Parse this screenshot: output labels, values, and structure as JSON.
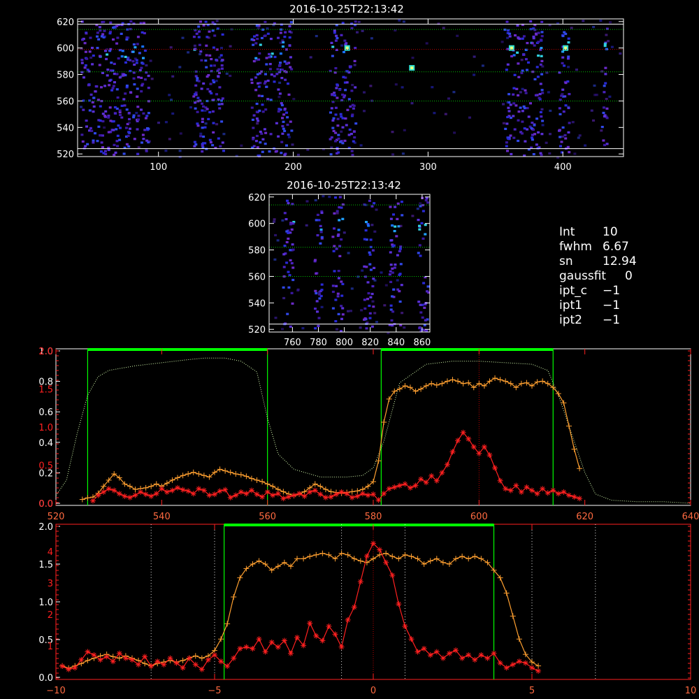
{
  "info": {
    "rows": [
      {
        "label": "Int",
        "value": "10"
      },
      {
        "label": "fwhm",
        "value": "6.67"
      },
      {
        "label": "sn",
        "value": "12.94"
      },
      {
        "label": "gaussfit",
        "value": "0"
      },
      {
        "label": "ipt_c",
        "value": "−1"
      },
      {
        "label": "ipt1",
        "value": "−1"
      },
      {
        "label": "ipt2",
        "value": "−1"
      }
    ]
  },
  "colors": {
    "frame": "#ffffff",
    "red_axis": "#ff2020",
    "orange": "#ffa030",
    "red": "#ff2020",
    "green": "#00ff00",
    "pale_green": "#d8ffb0",
    "dot_green": "#00c000",
    "dot_red": "#c00000"
  },
  "chart_data": [
    {
      "type": "heatmap",
      "title": "2016-10-25T22:13:42",
      "xlim": [
        40,
        445
      ],
      "ylim": [
        518,
        622
      ],
      "xticks": [
        "100",
        "200",
        "300",
        "400"
      ],
      "yticks": [
        "520",
        "540",
        "560",
        "580",
        "600",
        "620"
      ],
      "bands_x": [
        [
          42,
          92
        ],
        [
          125,
          148
        ],
        [
          168,
          198
        ],
        [
          226,
          246
        ],
        [
          356,
          384
        ],
        [
          396,
          404
        ],
        [
          428,
          432
        ]
      ],
      "hot_spots": [
        [
          240,
          600
        ],
        [
          362,
          600
        ],
        [
          402,
          600
        ],
        [
          288,
          585
        ]
      ],
      "hlines_white": [
        618,
        524
      ],
      "hlines_green": [
        614,
        582,
        560
      ],
      "hlines_red": [
        599
      ]
    },
    {
      "type": "heatmap",
      "title": "2016-10-25T22:13:42",
      "xlim": [
        742,
        866
      ],
      "ylim": [
        518,
        622
      ],
      "xticks": [
        "760",
        "780",
        "800",
        "820",
        "840",
        "860"
      ],
      "yticks": [
        "520",
        "540",
        "560",
        "580",
        "600",
        "620"
      ],
      "bands_x": [
        [
          752,
          760
        ],
        [
          776,
          782
        ],
        [
          790,
          798
        ],
        [
          814,
          822
        ],
        [
          834,
          844
        ],
        [
          856,
          864
        ]
      ],
      "hlines_green": [
        614,
        582,
        560
      ],
      "hlines_white": [
        524
      ]
    },
    {
      "type": "line",
      "xlim": [
        520,
        640
      ],
      "xticks": [
        "520",
        "540",
        "560",
        "580",
        "600",
        "620",
        "640"
      ],
      "left_axis_white": {
        "ylim": [
          0,
          1.0
        ],
        "ticks": [
          "0.0",
          "0.2",
          "0.4",
          "0.6",
          "0.8",
          "1.0"
        ]
      },
      "left_axis_red": {
        "ylim": [
          0,
          2.0
        ],
        "ticks": [
          "0.0",
          "0.5",
          "1.0",
          "1.5",
          "2.0"
        ]
      },
      "green_windows": [
        [
          526,
          560
        ],
        [
          581.5,
          614
        ]
      ],
      "vline_red_x": 600,
      "series": [
        {
          "role": "profile",
          "x": [
            520,
            522,
            524,
            526,
            528,
            530,
            535,
            540,
            545,
            548,
            552,
            555,
            558,
            560,
            562,
            565,
            570,
            575,
            578,
            580,
            582,
            585,
            590,
            595,
            600,
            605,
            610,
            613,
            615,
            618,
            620,
            622,
            625,
            630,
            635,
            640
          ],
          "y": [
            0.05,
            0.15,
            0.45,
            0.7,
            0.82,
            0.86,
            0.89,
            0.91,
            0.93,
            0.94,
            0.94,
            0.92,
            0.85,
            0.55,
            0.32,
            0.22,
            0.17,
            0.17,
            0.18,
            0.23,
            0.4,
            0.78,
            0.9,
            0.92,
            0.92,
            0.91,
            0.9,
            0.86,
            0.7,
            0.4,
            0.2,
            0.06,
            0.02,
            0.01,
            0.01,
            0.0
          ]
        },
        {
          "role": "orange",
          "x": [
            525,
            526,
            527,
            528,
            529,
            530,
            531,
            532,
            533,
            534,
            535,
            536,
            537,
            538,
            539,
            540,
            541,
            542,
            543,
            544,
            545,
            546,
            547,
            548,
            549,
            550,
            551,
            552,
            553,
            554,
            555,
            556,
            557,
            558,
            559,
            560,
            561,
            562,
            563,
            564,
            565,
            566,
            567,
            568,
            569,
            570,
            571,
            572,
            573,
            574,
            575,
            576,
            577,
            578,
            579,
            580,
            581,
            582,
            583,
            584,
            585,
            586,
            587,
            588,
            589,
            590,
            591,
            592,
            593,
            594,
            595,
            596,
            597,
            598,
            599,
            600,
            601,
            602,
            603,
            604,
            605,
            606,
            607,
            608,
            609,
            610,
            611,
            612,
            613,
            614,
            615,
            616,
            617,
            618,
            619
          ],
          "y": [
            0.05,
            0.07,
            0.08,
            0.13,
            0.22,
            0.3,
            0.38,
            0.33,
            0.25,
            0.22,
            0.18,
            0.19,
            0.2,
            0.22,
            0.25,
            0.22,
            0.26,
            0.3,
            0.33,
            0.36,
            0.38,
            0.4,
            0.38,
            0.36,
            0.34,
            0.4,
            0.44,
            0.42,
            0.4,
            0.38,
            0.37,
            0.35,
            0.32,
            0.3,
            0.28,
            0.25,
            0.22,
            0.18,
            0.15,
            0.12,
            0.1,
            0.12,
            0.15,
            0.2,
            0.25,
            0.22,
            0.18,
            0.15,
            0.14,
            0.13,
            0.14,
            0.15,
            0.16,
            0.18,
            0.22,
            0.28,
            0.55,
            1.05,
            1.35,
            1.45,
            1.48,
            1.52,
            1.5,
            1.45,
            1.48,
            1.52,
            1.55,
            1.53,
            1.55,
            1.58,
            1.6,
            1.58,
            1.55,
            1.56,
            1.5,
            1.55,
            1.52,
            1.58,
            1.62,
            1.6,
            1.58,
            1.55,
            1.5,
            1.55,
            1.56,
            1.52,
            1.57,
            1.58,
            1.55,
            1.5,
            1.42,
            1.3,
            1.0,
            0.7,
            0.45
          ],
          "ylim": [
            0,
            2.0
          ]
        },
        {
          "role": "red",
          "x": [
            527,
            528,
            529,
            530,
            531,
            532,
            533,
            534,
            535,
            536,
            537,
            538,
            539,
            540,
            541,
            542,
            543,
            544,
            545,
            546,
            547,
            548,
            549,
            550,
            551,
            552,
            553,
            554,
            555,
            556,
            557,
            558,
            559,
            560,
            561,
            562,
            563,
            564,
            565,
            566,
            567,
            568,
            569,
            570,
            571,
            572,
            573,
            574,
            575,
            576,
            577,
            578,
            579,
            580,
            581,
            582,
            583,
            584,
            585,
            586,
            587,
            588,
            589,
            590,
            591,
            592,
            593,
            594,
            595,
            596,
            597,
            598,
            599,
            600,
            601,
            602,
            603,
            604,
            605,
            606,
            607,
            608,
            609,
            610,
            611,
            612,
            613,
            614,
            615,
            616,
            617,
            618,
            619
          ],
          "y": [
            0.08,
            0.25,
            0.35,
            0.45,
            0.4,
            0.3,
            0.22,
            0.18,
            0.25,
            0.35,
            0.28,
            0.22,
            0.3,
            0.45,
            0.35,
            0.4,
            0.48,
            0.42,
            0.38,
            0.3,
            0.45,
            0.4,
            0.25,
            0.28,
            0.38,
            0.42,
            0.18,
            0.25,
            0.35,
            0.3,
            0.4,
            0.28,
            0.2,
            0.35,
            0.25,
            0.3,
            0.15,
            0.2,
            0.25,
            0.3,
            0.22,
            0.35,
            0.4,
            0.28,
            0.18,
            0.2,
            0.28,
            0.35,
            0.3,
            0.18,
            0.22,
            0.3,
            0.25,
            0.28,
            0.1,
            0.3,
            0.45,
            0.5,
            0.55,
            0.6,
            0.48,
            0.55,
            0.75,
            0.65,
            0.85,
            0.7,
            0.95,
            1.2,
            1.6,
            1.95,
            2.2,
            2.0,
            1.75,
            1.55,
            1.75,
            1.5,
            1.1,
            0.7,
            0.45,
            0.4,
            0.55,
            0.35,
            0.5,
            0.4,
            0.3,
            0.45,
            0.32,
            0.4,
            0.3,
            0.35,
            0.25,
            0.2,
            0.15
          ],
          "ylim": [
            0,
            4.8
          ]
        }
      ]
    },
    {
      "type": "line",
      "xlim": [
        -10,
        10
      ],
      "xticks": [
        "−10",
        "−5",
        "0",
        "5",
        "10"
      ],
      "left_axis_white": {
        "ylim": [
          0,
          2.0
        ],
        "ticks": [
          "0.0",
          "0.5",
          "1.0",
          "1.5",
          "2.0"
        ]
      },
      "left_axis_red": {
        "ylim": [
          0,
          4.8
        ],
        "ticks": [
          "1",
          "2",
          "3",
          "4"
        ]
      },
      "green_window": [
        -4.7,
        3.8
      ],
      "vlines_white_dotted": [
        -7,
        -5,
        -1,
        1,
        5,
        7
      ],
      "vline_red_x": 0,
      "series": [
        {
          "role": "orange",
          "x": [
            -9.8,
            -9.6,
            -9.4,
            -9.2,
            -9.0,
            -8.8,
            -8.6,
            -8.4,
            -8.2,
            -8.0,
            -7.8,
            -7.6,
            -7.4,
            -7.2,
            -7.0,
            -6.8,
            -6.6,
            -6.4,
            -6.2,
            -6.0,
            -5.8,
            -5.6,
            -5.4,
            -5.2,
            -5.0,
            -4.8,
            -4.6,
            -4.4,
            -4.2,
            -4.0,
            -3.8,
            -3.6,
            -3.4,
            -3.2,
            -3.0,
            -2.8,
            -2.6,
            -2.4,
            -2.2,
            -2.0,
            -1.8,
            -1.6,
            -1.4,
            -1.2,
            -1.0,
            -0.8,
            -0.6,
            -0.4,
            -0.2,
            0.0,
            0.2,
            0.4,
            0.6,
            0.8,
            1.0,
            1.2,
            1.4,
            1.6,
            1.8,
            2.0,
            2.2,
            2.4,
            2.6,
            2.8,
            3.0,
            3.2,
            3.4,
            3.6,
            3.8,
            4.0,
            4.2,
            4.4,
            4.6,
            4.8,
            5.0,
            5.2
          ],
          "y": [
            0.15,
            0.12,
            0.15,
            0.18,
            0.22,
            0.25,
            0.28,
            0.3,
            0.27,
            0.25,
            0.28,
            0.25,
            0.22,
            0.18,
            0.15,
            0.18,
            0.2,
            0.22,
            0.2,
            0.22,
            0.25,
            0.28,
            0.25,
            0.28,
            0.35,
            0.5,
            0.7,
            1.05,
            1.3,
            1.42,
            1.48,
            1.52,
            1.48,
            1.4,
            1.45,
            1.5,
            1.45,
            1.55,
            1.55,
            1.58,
            1.6,
            1.62,
            1.6,
            1.55,
            1.62,
            1.6,
            1.55,
            1.52,
            1.5,
            1.55,
            1.6,
            1.62,
            1.58,
            1.55,
            1.6,
            1.58,
            1.55,
            1.48,
            1.52,
            1.55,
            1.5,
            1.48,
            1.55,
            1.58,
            1.55,
            1.58,
            1.55,
            1.5,
            1.4,
            1.3,
            1.1,
            0.8,
            0.5,
            0.3,
            0.2,
            0.15
          ],
          "ylim": [
            0,
            2.0
          ]
        },
        {
          "role": "red",
          "x": [
            -9.8,
            -9.6,
            -9.4,
            -9.2,
            -9.0,
            -8.8,
            -8.6,
            -8.4,
            -8.2,
            -8.0,
            -7.8,
            -7.6,
            -7.4,
            -7.2,
            -7.0,
            -6.8,
            -6.6,
            -6.4,
            -6.2,
            -6.0,
            -5.8,
            -5.6,
            -5.4,
            -5.2,
            -5.0,
            -4.8,
            -4.6,
            -4.4,
            -4.2,
            -4.0,
            -3.8,
            -3.6,
            -3.4,
            -3.2,
            -3.0,
            -2.8,
            -2.6,
            -2.4,
            -2.2,
            -2.0,
            -1.8,
            -1.6,
            -1.4,
            -1.2,
            -1.0,
            -0.8,
            -0.6,
            -0.4,
            -0.2,
            0.0,
            0.2,
            0.4,
            0.6,
            0.8,
            1.0,
            1.2,
            1.4,
            1.6,
            1.8,
            2.0,
            2.2,
            2.4,
            2.6,
            2.8,
            3.0,
            3.2,
            3.4,
            3.6,
            3.8,
            4.0,
            4.2,
            4.4,
            4.6,
            4.8,
            5.0,
            5.2
          ],
          "y": [
            0.35,
            0.25,
            0.3,
            0.55,
            0.8,
            0.7,
            0.55,
            0.65,
            0.5,
            0.75,
            0.6,
            0.55,
            0.4,
            0.65,
            0.35,
            0.5,
            0.4,
            0.6,
            0.45,
            0.3,
            0.6,
            0.4,
            0.25,
            0.55,
            0.7,
            0.5,
            0.35,
            0.6,
            0.9,
            0.95,
            0.9,
            1.2,
            0.8,
            1.1,
            0.95,
            1.15,
            0.75,
            1.25,
            1.0,
            1.7,
            1.3,
            1.15,
            1.6,
            1.35,
            0.95,
            1.8,
            2.2,
            3.0,
            3.8,
            4.2,
            4.0,
            3.6,
            3.2,
            2.3,
            1.6,
            1.2,
            0.8,
            0.9,
            0.7,
            0.8,
            0.6,
            0.75,
            0.85,
            0.6,
            0.7,
            0.55,
            0.7,
            0.6,
            0.75,
            0.45,
            0.3,
            0.4,
            0.5,
            0.45,
            0.3,
            0.2
          ],
          "ylim": [
            0,
            4.8
          ]
        }
      ]
    }
  ]
}
